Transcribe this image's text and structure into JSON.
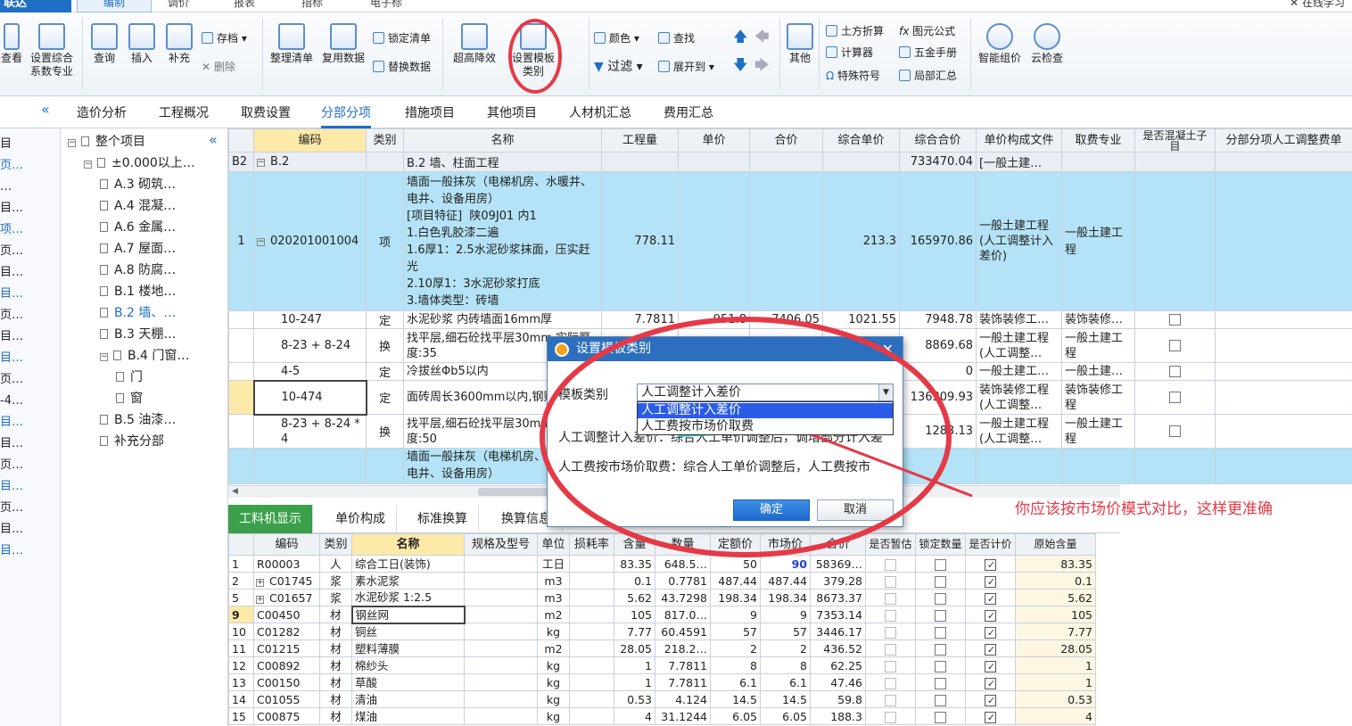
{
  "app": {
    "logo": "联达",
    "menu_tabs": [
      "编制",
      "调价",
      "报表",
      "指标",
      "电子标"
    ],
    "help": "✕ 在线学习"
  },
  "ribbon": {
    "buttons": [
      "查看",
      "设置综合系数专业",
      "查询",
      "插入",
      "补充",
      "整理清单",
      "复用数据",
      "超高降效",
      "设置模板类别",
      "其他",
      "智能组价",
      "云检查"
    ],
    "small": [
      "存档",
      "删除",
      "锁定清单",
      "替换数据",
      "颜色",
      "查找",
      "过滤",
      "展开到",
      "土方折算",
      "计算器",
      "特殊符号",
      "图元公式",
      "五金手册",
      "局部汇总"
    ]
  },
  "tabs": [
    "造价分析",
    "工程概况",
    "取费设置",
    "分部分项",
    "措施项目",
    "其他项目",
    "人材机汇总",
    "费用汇总"
  ],
  "left_partial": [
    "目",
    "页…",
    "…",
    "目…",
    "项…",
    "页…",
    "目…",
    "目…",
    "页…",
    "目…",
    "目…",
    "页…",
    "-4…",
    "目…",
    "目…",
    "页…",
    "目…",
    "页…",
    "目…",
    "目…"
  ],
  "tree": [
    {
      "label": "整个项目",
      "level": 0
    },
    {
      "label": "±0.000以上…",
      "level": 1
    },
    {
      "label": "A.3 砌筑…",
      "level": 2
    },
    {
      "label": "A.4 混凝…",
      "level": 2
    },
    {
      "label": "A.6 金属…",
      "level": 2
    },
    {
      "label": "A.7 屋面…",
      "level": 2
    },
    {
      "label": "A.8 防腐…",
      "level": 2
    },
    {
      "label": "B.1 楼地…",
      "level": 2
    },
    {
      "label": "B.2 墙、…",
      "level": 2
    },
    {
      "label": "B.3 天棚…",
      "level": 2
    },
    {
      "label": "B.4 门窗…",
      "level": 2
    },
    {
      "label": "门",
      "level": 3
    },
    {
      "label": "窗",
      "level": 3
    },
    {
      "label": "B.5 油漆…",
      "level": 2
    },
    {
      "label": "补充分部",
      "level": 2
    }
  ],
  "grid": {
    "headers": [
      "编码",
      "类别",
      "名称",
      "工程量",
      "单价",
      "合价",
      "综合单价",
      "综合合价",
      "单价构成文件",
      "取费专业",
      "是否混凝土子目",
      "分部分项人工调整费单"
    ],
    "section": {
      "id": "B2",
      "code": "B.2",
      "name": "B.2   墙、柱面工程",
      "total": "733470.04",
      "file": "[一般土建…"
    },
    "row1": {
      "no": "1",
      "code": "020201001004",
      "type": "项",
      "name": "墙面一般抹灰（电梯机房、水暖井、电井、设备用房）\n[项目特征]  陕09J01 内1\n1.白色乳胶漆二遍\n1.6厚1：2.5水泥砂浆抹面，压实赶光\n2.10厚1：3水泥砂浆打底\n3.墙体类型：砖墙",
      "qty": "778.11",
      "unit_total": "213.3",
      "total": "165970.86",
      "file": "一般土建工程(人工调整计入差价)",
      "major": "一般土建工程"
    },
    "subrows": [
      {
        "code": "10-247",
        "type": "定",
        "name": "水泥砂浆 内砖墙面16mm厚",
        "qty": "7.7811",
        "price": "951.8",
        "sum": "7406.05",
        "up": "1021.55",
        "total": "7948.78",
        "file": "装饰装修工…",
        "major": "装饰装修…"
      },
      {
        "code": "8-23 + 8-24",
        "type": "换",
        "name": "找平层,细石砼找平层30mm 实际厚度:35",
        "qty": "",
        "price": "",
        "sum": "",
        "up": "",
        "total": "8869.68",
        "file": "一般土建工程(人工调整…",
        "major": "一般土建工程"
      },
      {
        "code": "4-5",
        "type": "定",
        "name": "冷拔丝Φb5以内",
        "qty": "",
        "price": "",
        "sum": "",
        "up": "",
        "total": "0",
        "file": "一般土建工…",
        "major": "一般土建…"
      },
      {
        "code": "10-474",
        "type": "定",
        "name": "面砖周长3600mm以内,钢贴",
        "qty": "",
        "price": "",
        "sum": "",
        "up": "",
        "total": "136309.93",
        "file": "装饰装修工程(人工调整…",
        "major": "装饰装修工程"
      },
      {
        "code": "8-23 + 8-24 * 4",
        "type": "换",
        "name": "找平层,细石砼找平层30mm 实际厚度:50",
        "qty": "",
        "price": "",
        "sum": "",
        "up": "",
        "total": "1283.13",
        "file": "一般土建工程(人工调整…",
        "major": "一般土建工程"
      }
    ],
    "row2_name": "墙面一般抹灰（电梯机房、水暖井、电井、设备用房）"
  },
  "bottom": {
    "tabs": [
      "工料机显示",
      "单价构成",
      "标准换算",
      "换算信息"
    ],
    "headers": [
      "编码",
      "类别",
      "名称",
      "规格及型号",
      "单位",
      "损耗率",
      "含量",
      "数量",
      "定额价",
      "市场价",
      "合价",
      "是否暂估",
      "锁定数量",
      "是否计价",
      "原始含量"
    ],
    "rows": [
      {
        "no": "1",
        "code": "R00003",
        "type": "人",
        "name": "综合工日(装饰)",
        "unit": "工日",
        "content": "83.35",
        "qty": "648.5…",
        "base": "50",
        "market": "90",
        "sum": "58369…",
        "est": false,
        "lock": false,
        "price": true,
        "orig": "83.35"
      },
      {
        "no": "2",
        "code": "C01745",
        "type": "浆",
        "name": "素水泥浆",
        "unit": "m3",
        "content": "0.1",
        "qty": "0.7781",
        "base": "487.44",
        "market": "487.44",
        "sum": "379.28",
        "est": false,
        "lock": false,
        "price": true,
        "orig": "0.1"
      },
      {
        "no": "5",
        "code": "C01657",
        "type": "浆",
        "name": "水泥砂浆 1:2.5",
        "unit": "m3",
        "content": "5.62",
        "qty": "43.7298",
        "base": "198.34",
        "market": "198.34",
        "sum": "8673.37",
        "est": false,
        "lock": false,
        "price": true,
        "orig": "5.62"
      },
      {
        "no": "9",
        "code": "C00450",
        "type": "材",
        "name": "钢丝网",
        "unit": "m2",
        "content": "105",
        "qty": "817.0…",
        "base": "9",
        "market": "9",
        "sum": "7353.14",
        "est": false,
        "lock": false,
        "price": true,
        "orig": "105"
      },
      {
        "no": "10",
        "code": "C01282",
        "type": "材",
        "name": "铜丝",
        "unit": "kg",
        "content": "7.77",
        "qty": "60.4591",
        "base": "57",
        "market": "57",
        "sum": "3446.17",
        "est": false,
        "lock": false,
        "price": true,
        "orig": "7.77"
      },
      {
        "no": "11",
        "code": "C01215",
        "type": "材",
        "name": "塑料薄膜",
        "unit": "m2",
        "content": "28.05",
        "qty": "218.2…",
        "base": "2",
        "market": "2",
        "sum": "436.52",
        "est": false,
        "lock": false,
        "price": true,
        "orig": "28.05"
      },
      {
        "no": "12",
        "code": "C00892",
        "type": "材",
        "name": "棉纱头",
        "unit": "kg",
        "content": "1",
        "qty": "7.7811",
        "base": "8",
        "market": "8",
        "sum": "62.25",
        "est": false,
        "lock": false,
        "price": true,
        "orig": "1"
      },
      {
        "no": "13",
        "code": "C00150",
        "type": "材",
        "name": "草酸",
        "unit": "kg",
        "content": "1",
        "qty": "7.7811",
        "base": "6.1",
        "market": "6.1",
        "sum": "47.46",
        "est": false,
        "lock": false,
        "price": true,
        "orig": "1"
      },
      {
        "no": "14",
        "code": "C01055",
        "type": "材",
        "name": "清油",
        "unit": "kg",
        "content": "0.53",
        "qty": "4.124",
        "base": "14.5",
        "market": "14.5",
        "sum": "59.8",
        "est": false,
        "lock": false,
        "price": true,
        "orig": "0.53"
      },
      {
        "no": "15",
        "code": "C00875",
        "type": "材",
        "name": "煤油",
        "unit": "kg",
        "content": "4",
        "qty": "31.1244",
        "base": "6.05",
        "market": "6.05",
        "sum": "188.3",
        "est": false,
        "lock": false,
        "price": true,
        "orig": "4"
      }
    ]
  },
  "dialog": {
    "title": "设置模板类别",
    "label": "模板类别",
    "selected": "人工调整计入差价",
    "options": [
      "人工调整计入差价",
      "人工费按市场价取费"
    ],
    "desc1": "人工调整计入差价：综合人工单价调整后，调增部分计入差",
    "desc2": "人工费按市场价取费：综合人工单价调整后，人工费按市",
    "ok": "确定",
    "cancel": "取消",
    "close": "✕"
  },
  "annotation": {
    "text": "你应该按市场价模式对比，这样更准确",
    "color": "#e63946"
  },
  "colors": {
    "accent": "#1f6fc5",
    "highlight": "#b4e3f7",
    "green": "#3aa04a"
  }
}
